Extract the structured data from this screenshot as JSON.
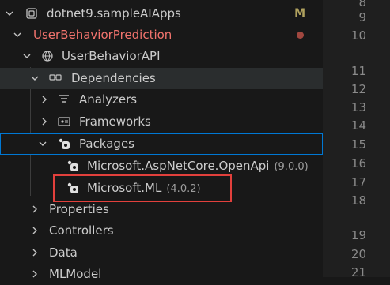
{
  "explorer": {
    "root": {
      "label": "dotnet9.sampleAIApps",
      "badge": "M"
    },
    "project_folder": {
      "label": "UserBehaviorPrediction"
    },
    "project": {
      "label": "UserBehaviorAPI"
    },
    "dependencies": {
      "label": "Dependencies"
    },
    "analyzers": {
      "label": "Analyzers"
    },
    "frameworks": {
      "label": "Frameworks"
    },
    "packages": {
      "label": "Packages"
    },
    "pkg_openapi": {
      "label": "Microsoft.AspNetCore.OpenApi",
      "version": "(9.0.0)"
    },
    "pkg_ml": {
      "label": "Microsoft.ML",
      "version": "(4.0.2)"
    },
    "properties": {
      "label": "Properties"
    },
    "controllers": {
      "label": "Controllers"
    },
    "data": {
      "label": "Data"
    },
    "mlmodel": {
      "label": "MLModel"
    }
  },
  "gutter": {
    "line_numbers": [
      "8",
      "9",
      "10",
      "",
      "11",
      "12",
      "13",
      "14",
      "15",
      "16",
      "17",
      "18",
      "",
      "19",
      "20",
      "21"
    ]
  },
  "colors": {
    "modified_badge": "#b0a15e",
    "error_label": "#f2736d",
    "error_dot": "#a1473f",
    "selection_border": "#0078d4",
    "highlight_box": "#e2403c"
  }
}
